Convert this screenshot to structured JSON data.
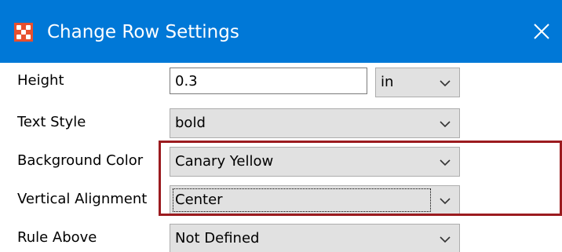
{
  "window": {
    "title": "Change Row Settings",
    "titlebar_color": "#0078d7",
    "app_icon": "grid-dots-icon",
    "close_icon": "close-icon"
  },
  "fields": {
    "height": {
      "label": "Height",
      "value": "0.3",
      "unit": "in"
    },
    "text_style": {
      "label": "Text Style",
      "value": "bold"
    },
    "background_color": {
      "label": "Background Color",
      "value": "Canary Yellow"
    },
    "vertical_alignment": {
      "label": "Vertical Alignment",
      "value": "Center"
    },
    "rule_above": {
      "label": "Rule Above",
      "value": "Not Defined"
    }
  },
  "annotation": {
    "color": "#9b1b1f"
  }
}
